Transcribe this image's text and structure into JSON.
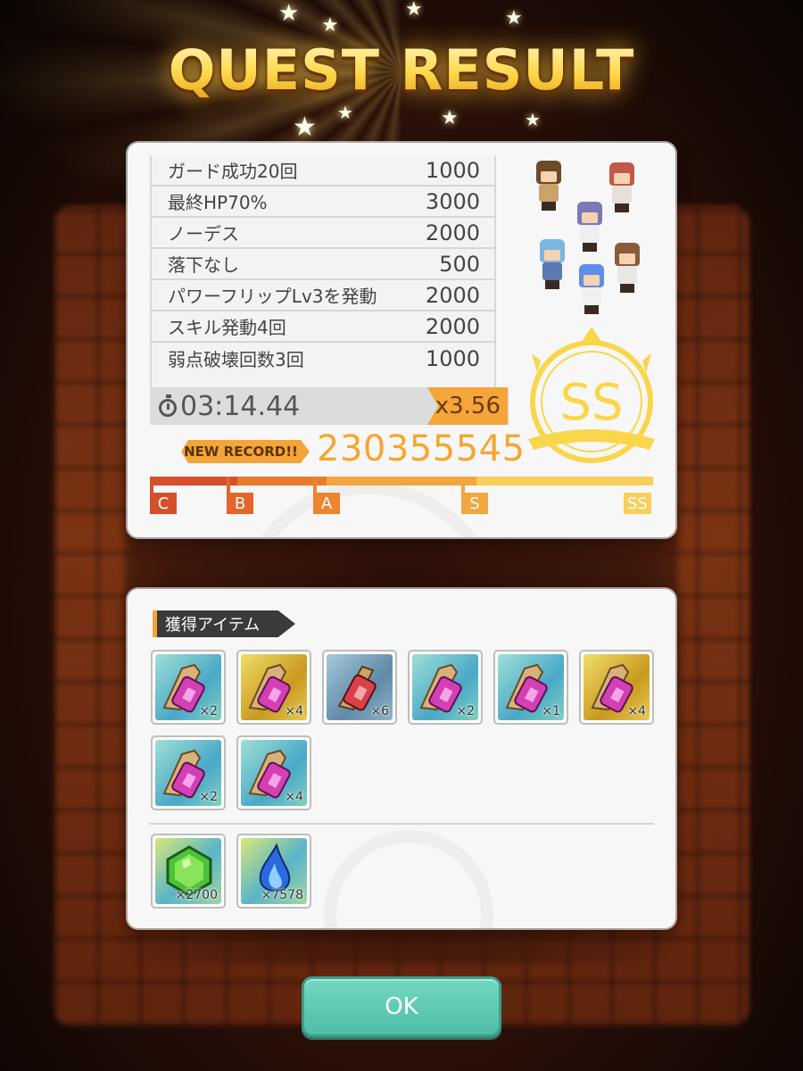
{
  "title": "QUEST RESULT",
  "bonuses": [
    {
      "label": "ガード成功20回",
      "points": "1000"
    },
    {
      "label": "最終HP70%",
      "points": "3000"
    },
    {
      "label": "ノーデス",
      "points": "2000"
    },
    {
      "label": "落下なし",
      "points": "500"
    },
    {
      "label": "パワーフリップLv3を発動",
      "points": "2000"
    },
    {
      "label": "スキル発動4回",
      "points": "2000"
    },
    {
      "label": "弱点破壊回数3回",
      "points": "1000"
    }
  ],
  "timer": "03:14.44",
  "multiplier": "x3.56",
  "new_record_label": "NEW RECORD!!",
  "score": "230355545",
  "rank": "SS",
  "grade_labels": [
    "C",
    "B",
    "A",
    "S",
    "SS"
  ],
  "items_section_label": "獲得アイテム",
  "items": [
    {
      "icon": "pink-potion-scroll-icon",
      "qty": "×2",
      "bg": "teal"
    },
    {
      "icon": "pink-potion-scroll-icon",
      "qty": "×4",
      "bg": "gold"
    },
    {
      "icon": "red-potion-icon",
      "qty": "×6",
      "bg": "blue"
    },
    {
      "icon": "pink-potion-scroll-icon",
      "qty": "×2",
      "bg": "teal"
    },
    {
      "icon": "pink-potion-scroll-icon",
      "qty": "×1",
      "bg": "teal"
    },
    {
      "icon": "pink-potion-scroll-icon",
      "qty": "×4",
      "bg": "gold"
    },
    {
      "icon": "pink-potion-scroll-icon",
      "qty": "×2",
      "bg": "teal"
    },
    {
      "icon": "pink-potion-scroll-icon",
      "qty": "×4",
      "bg": "teal"
    }
  ],
  "currencies": [
    {
      "icon": "green-gem-icon",
      "qty": "×2700"
    },
    {
      "icon": "blue-flame-icon",
      "qty": "×7578"
    }
  ],
  "ok_label": "OK",
  "colors": {
    "accent_orange": "#f5a53a",
    "score_orange": "#f7a531",
    "rank_gold": "#f9d64a",
    "ok_teal": "#5cc9b2"
  }
}
